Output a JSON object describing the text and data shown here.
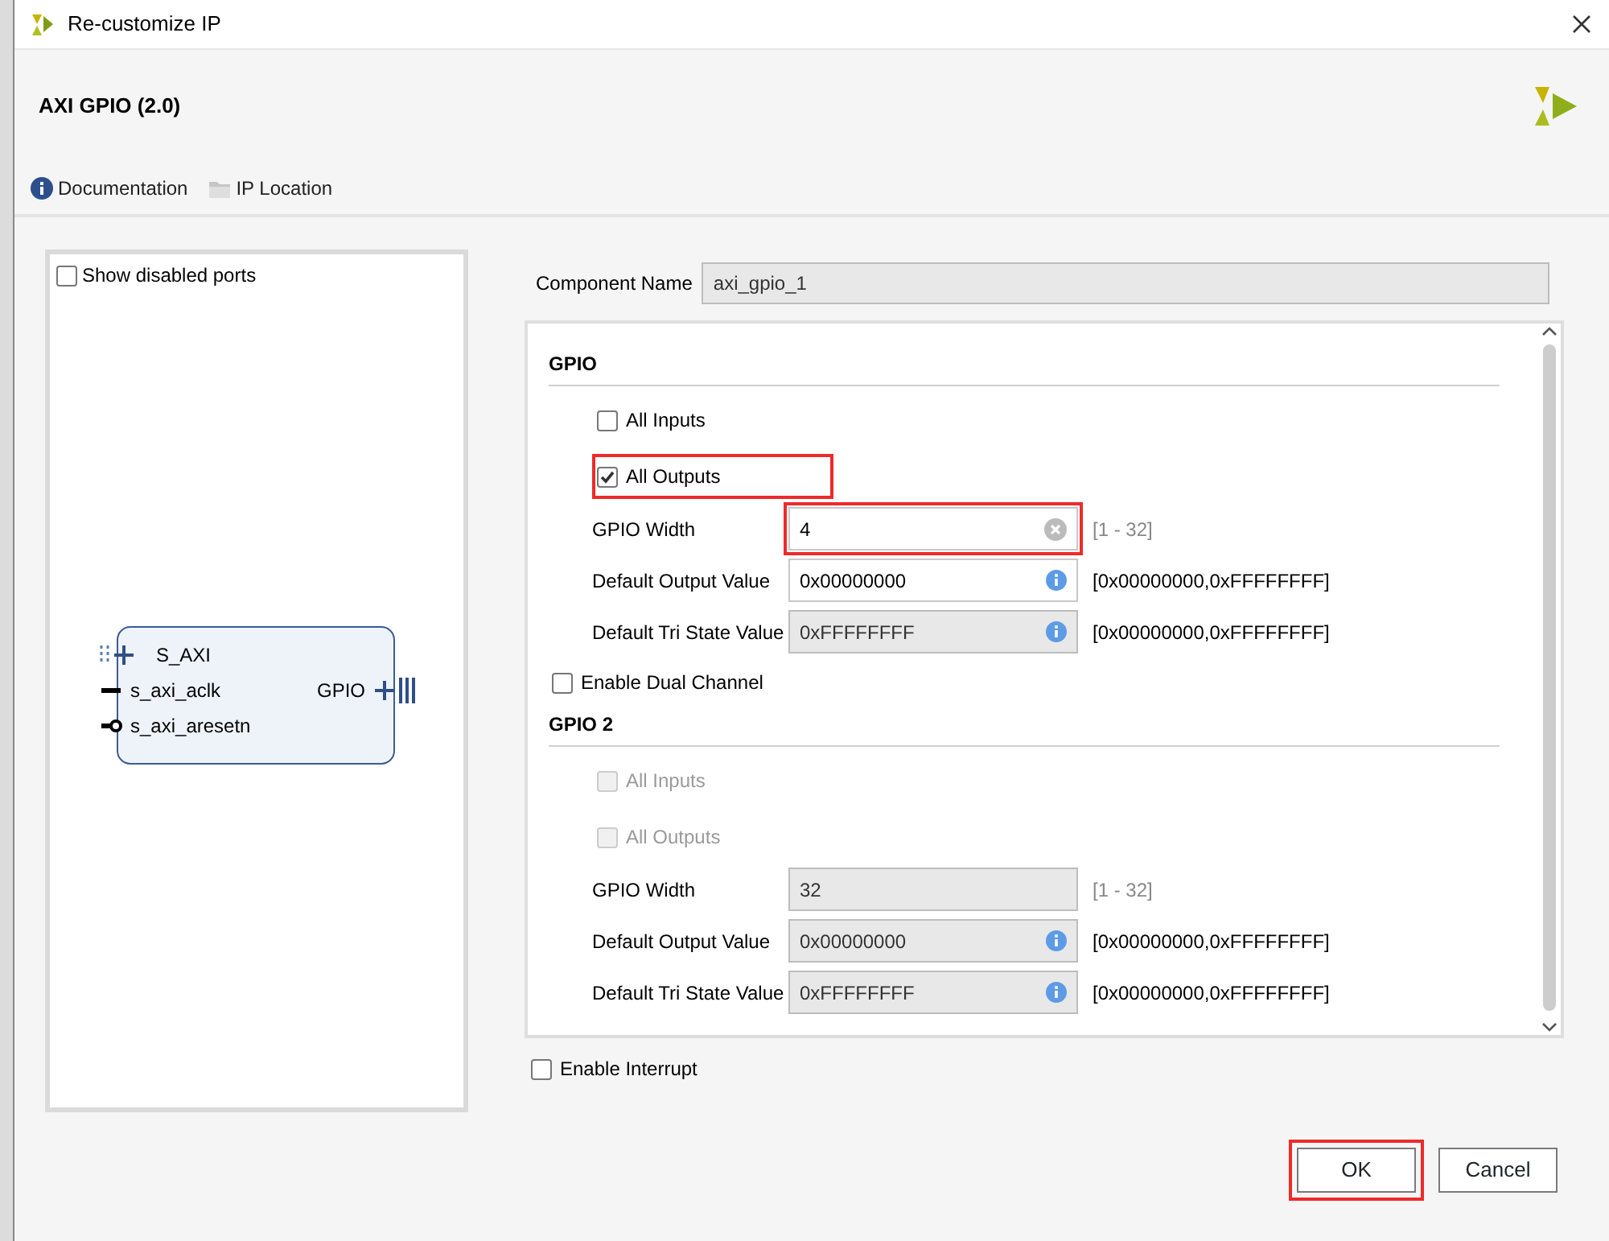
{
  "window": {
    "title": "Re-customize IP"
  },
  "ip_title": "AXI GPIO (2.0)",
  "toolbar": [
    {
      "kind": "info",
      "label": "Documentation"
    },
    {
      "kind": "folder",
      "label": "IP Location"
    }
  ],
  "symbol_panel": {
    "show_disabled_ports": {
      "label": "Show disabled ports",
      "checked": false
    },
    "left_ports": [
      {
        "kind": "bus",
        "name": "S_AXI"
      },
      {
        "kind": "clock",
        "name": "s_axi_aclk"
      },
      {
        "kind": "reset",
        "name": "s_axi_aresetn"
      }
    ],
    "right_ports": [
      {
        "kind": "bus",
        "name": "GPIO"
      }
    ]
  },
  "component_name": {
    "label": "Component Name",
    "value": "axi_gpio_1"
  },
  "pane_items": [
    {
      "kind": "heading",
      "text": "GPIO"
    },
    {
      "kind": "checkbox",
      "label": "All Inputs",
      "checked": false,
      "disabled": false,
      "highlighted": false
    },
    {
      "kind": "checkbox",
      "label": "All Outputs",
      "checked": true,
      "disabled": false,
      "highlighted": true
    },
    {
      "kind": "width_field",
      "label": "GPIO Width",
      "value": "4",
      "range": "[1 - 32]",
      "disabled": false,
      "highlighted": true
    },
    {
      "kind": "value_field",
      "label": "Default Output Value",
      "value": "0x00000000",
      "range": "[0x00000000,0xFFFFFFFF]",
      "disabled": false,
      "highlighted": false
    },
    {
      "kind": "value_field",
      "label": "Default Tri State Value",
      "value": "0xFFFFFFFF",
      "range": "[0x00000000,0xFFFFFFFF]",
      "disabled": true,
      "highlighted": false
    },
    {
      "kind": "option",
      "label": "Enable Dual Channel",
      "checked": false
    },
    {
      "kind": "heading",
      "text": "GPIO 2"
    },
    {
      "kind": "checkbox",
      "label": "All Inputs",
      "checked": false,
      "disabled": true,
      "highlighted": false
    },
    {
      "kind": "checkbox",
      "label": "All Outputs",
      "checked": false,
      "disabled": true,
      "highlighted": false
    },
    {
      "kind": "width_field",
      "label": "GPIO Width",
      "value": "32",
      "range": "[1 - 32]",
      "disabled": true,
      "highlighted": false
    },
    {
      "kind": "value_field",
      "label": "Default Output Value",
      "value": "0x00000000",
      "range": "[0x00000000,0xFFFFFFFF]",
      "disabled": true,
      "highlighted": false
    },
    {
      "kind": "value_field",
      "label": "Default Tri State Value",
      "value": "0xFFFFFFFF",
      "range": "[0x00000000,0xFFFFFFFF]",
      "disabled": true,
      "highlighted": false
    }
  ],
  "enable_interrupt": {
    "label": "Enable Interrupt",
    "checked": false
  },
  "buttons": [
    {
      "label": "OK",
      "highlighted": true
    },
    {
      "label": "Cancel",
      "highlighted": false
    }
  ]
}
